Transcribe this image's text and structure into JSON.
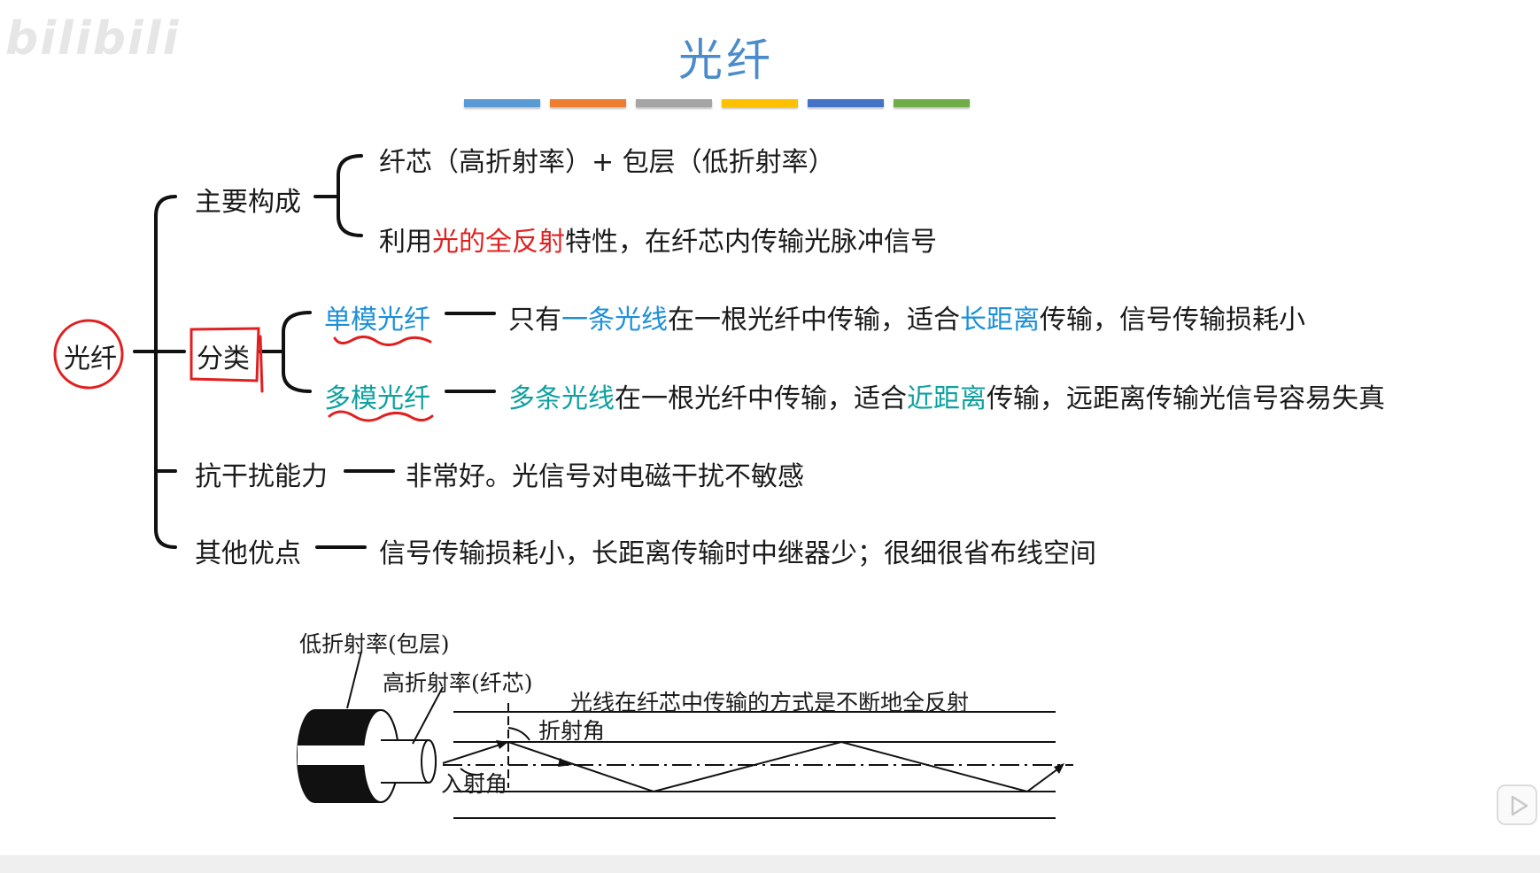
{
  "watermark": {
    "logo": "bilibili"
  },
  "title": "光纤",
  "colors": {
    "title": "#4a8ccb",
    "bars": [
      "#5b9bd5",
      "#ed7d31",
      "#a5a5a5",
      "#ffc000",
      "#4472c4",
      "#70ad47"
    ],
    "red": "#e02020",
    "blue": "#1e90d8",
    "teal": "#0fa0a0"
  },
  "root": "光纤",
  "branches": {
    "composition": {
      "label": "主要构成",
      "line1": "纤芯（高折射率）+ 包层（低折射率）",
      "line2": {
        "pre": "利用",
        "highlight": "光的全反射",
        "post": "特性，在纤芯内传输光脉冲信号"
      }
    },
    "classification": {
      "label": "分类",
      "single": {
        "label": "单模光纤",
        "pre": "只有",
        "h1": "一条光线",
        "mid": "在一根光纤中传输，适合",
        "h2": "长距离",
        "post": "传输，信号传输损耗小"
      },
      "multi": {
        "label": "多模光纤",
        "h1": "多条光线",
        "mid": "在一根光纤中传输，适合",
        "h2": "近距离",
        "post": "传输，远距离传输光信号容易失真"
      }
    },
    "anti_interference": {
      "label": "抗干扰能力",
      "desc": "非常好。光信号对电磁干扰不敏感"
    },
    "other": {
      "label": "其他优点",
      "desc": "信号传输损耗小，长距离传输时中继器少；很细很省布线空间"
    }
  },
  "figure": {
    "cladding_label": "低折射率(包层)",
    "core_label": "高折射率(纤芯)",
    "caption": "光线在纤芯中传输的方式是不断地全反射",
    "refraction_angle": "折射角",
    "incidence_angle": "入射角"
  }
}
